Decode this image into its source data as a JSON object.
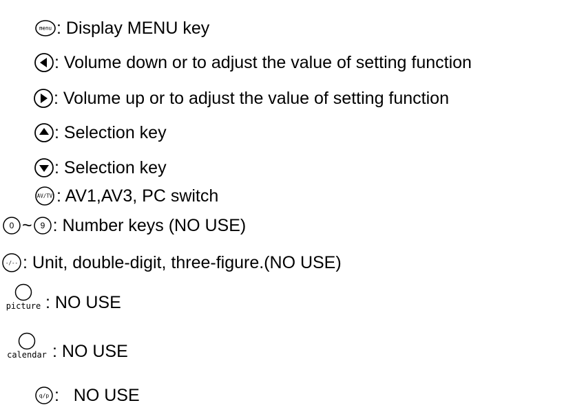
{
  "items": [
    {
      "icon": "menu-key-icon",
      "icon_text": "menu",
      "desc": ": Display MENU key"
    },
    {
      "icon": "left-arrow-key-icon",
      "desc": ": Volume down or to adjust the value of setting function"
    },
    {
      "icon": "right-arrow-key-icon",
      "desc": ": Volume up or to adjust the value of setting function"
    },
    {
      "icon": "up-arrow-key-icon",
      "desc": ": Selection key"
    },
    {
      "icon": "down-arrow-key-icon",
      "desc": ": Selection key"
    },
    {
      "icon": "av-tv-key-icon",
      "icon_text": "AV/TV",
      "desc": ": AV1,AV3, PC switch"
    },
    {
      "icon": "number-keys-icon",
      "icon_text_start": "0",
      "separator": "~",
      "icon_text_end": "9",
      "desc": ": Number keys (NO USE)"
    },
    {
      "icon": "digit-key-icon",
      "icon_text": "-/--",
      "desc": ": Unit, double-digit, three-figure.(NO USE)"
    },
    {
      "icon": "picture-key-icon",
      "icon_text": "picture",
      "desc": ": NO USE"
    },
    {
      "icon": "calendar-key-icon",
      "icon_text": "calendar",
      "desc": ": NO USE"
    },
    {
      "icon": "swap-key-icon",
      "icon_text": "q/p",
      "desc": ":   NO USE"
    }
  ]
}
